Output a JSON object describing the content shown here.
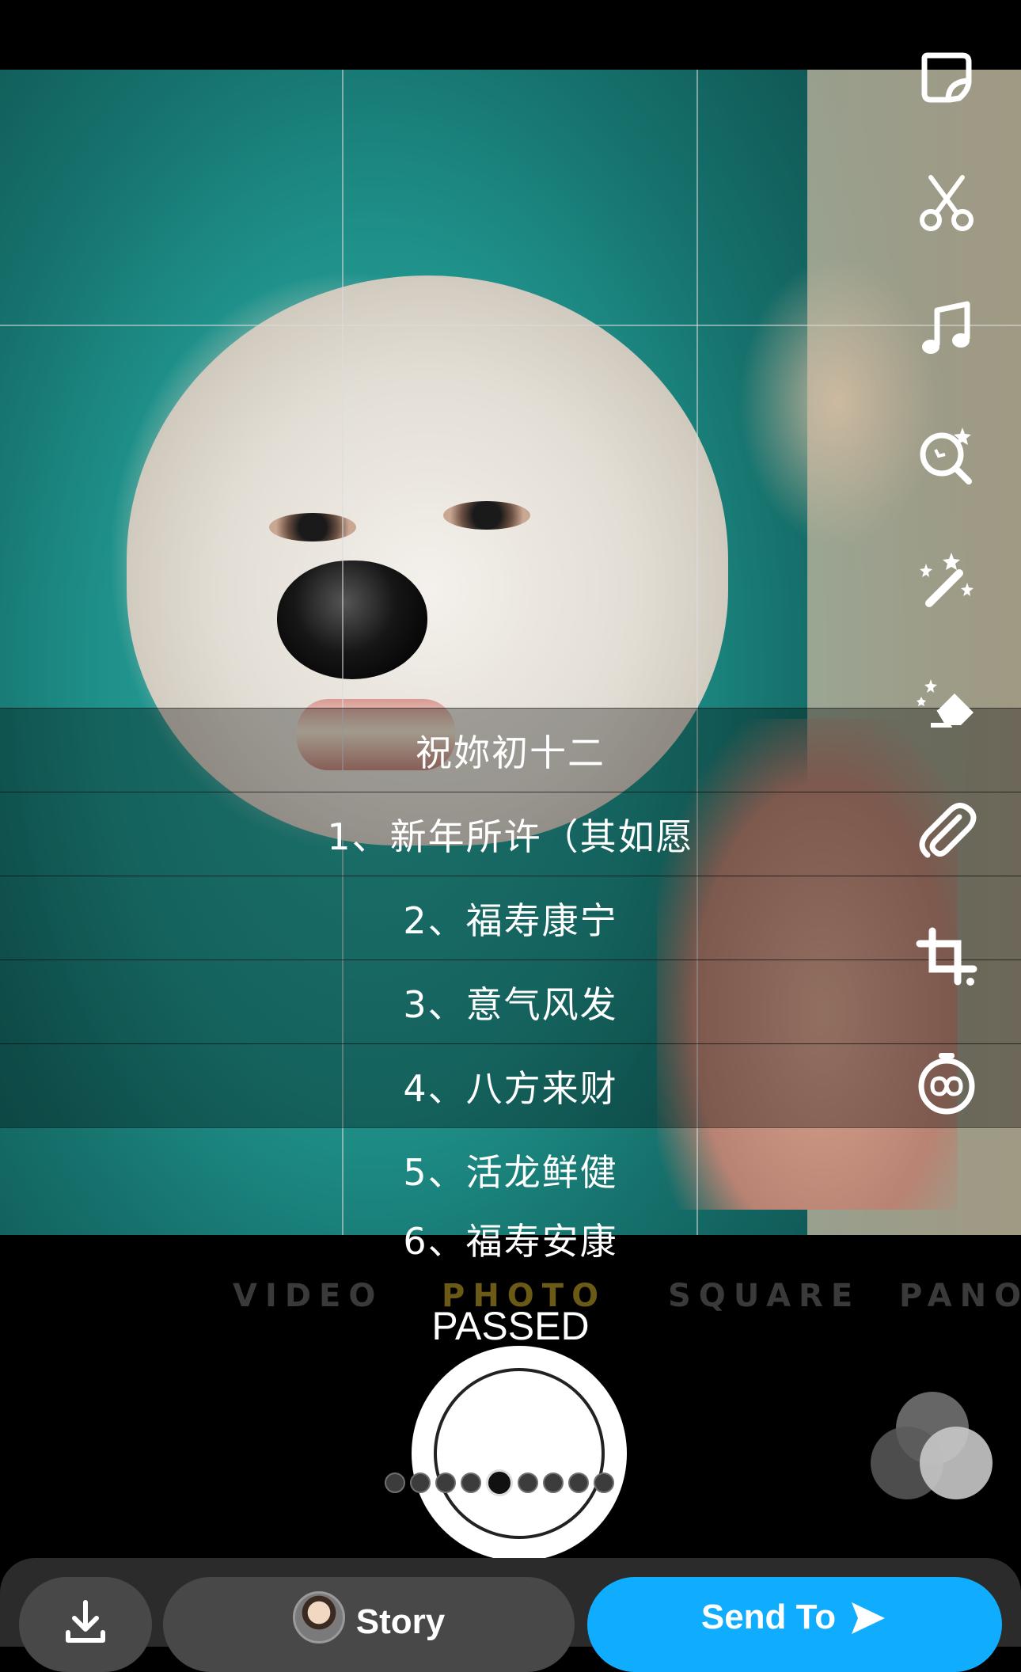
{
  "caption": {
    "lines": [
      "祝妳初十二",
      "1、新年所许（其如愿",
      "2、福寿康宁",
      "3、意气风发",
      "4、八方来财",
      "5、活龙鲜健",
      "6、福寿安康"
    ]
  },
  "tools": [
    {
      "icon": "sticker-icon"
    },
    {
      "icon": "scissors-icon"
    },
    {
      "icon": "music-note-icon"
    },
    {
      "icon": "lens-search-icon"
    },
    {
      "icon": "magic-wand-icon"
    },
    {
      "icon": "magic-eraser-icon"
    },
    {
      "icon": "paperclip-icon"
    },
    {
      "icon": "crop-icon"
    },
    {
      "icon": "timer-loop-icon"
    }
  ],
  "camera_modes": {
    "video": "VIDEO",
    "photo": "PHOTO",
    "square": "SQUARE",
    "pano": "PANO",
    "active": "PHOTO"
  },
  "status_text": "PASSED",
  "carousel": {
    "count": 9,
    "active_index": 4
  },
  "bottom_bar": {
    "save_icon": "download-icon",
    "story_label": "Story",
    "send_label": "Send To",
    "send_icon": "arrow-right-icon"
  },
  "colors": {
    "send_button": "#10adff",
    "panel": "#484848"
  }
}
